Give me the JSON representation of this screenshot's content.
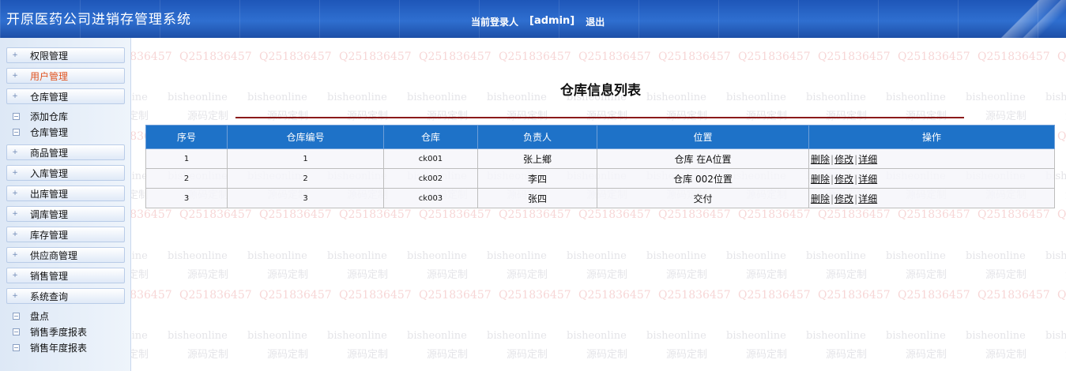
{
  "header": {
    "app_title": "开原医药公司进销存管理系统",
    "user_label": "当前登录人",
    "username": "[admin]",
    "logout": "退出"
  },
  "sidebar": {
    "items": [
      {
        "label": "权限管理",
        "active": false
      },
      {
        "label": "用户管理",
        "active": true
      },
      {
        "label": "仓库管理",
        "active": false
      },
      {
        "label": "添加仓库"
      },
      {
        "label": "仓库管理"
      },
      {
        "label": "商品管理",
        "active": false
      },
      {
        "label": "入库管理",
        "active": false
      },
      {
        "label": "出库管理",
        "active": false
      },
      {
        "label": "调库管理",
        "active": false
      },
      {
        "label": "库存管理",
        "active": false
      },
      {
        "label": "供应商管理",
        "active": false
      },
      {
        "label": "销售管理",
        "active": false
      },
      {
        "label": "系统查询",
        "active": false
      },
      {
        "label": "盘点"
      },
      {
        "label": "销售季度报表"
      },
      {
        "label": "销售年度报表"
      }
    ]
  },
  "watermark": {
    "qq": "Q2518364​57",
    "site": "bisheonline",
    "custom": "源码定制"
  },
  "main": {
    "title": "仓库信息列表",
    "columns": [
      "序号",
      "仓库编号",
      "仓库",
      "负责人",
      "位置",
      "操作"
    ],
    "rows": [
      {
        "no": "1",
        "code": "1",
        "name": "ck001",
        "manager": "张上鄉",
        "location": "仓库 在A位置"
      },
      {
        "no": "2",
        "code": "2",
        "name": "ck002",
        "manager": "李四",
        "location": "仓库 002位置"
      },
      {
        "no": "3",
        "code": "3",
        "name": "ck003",
        "manager": "张四",
        "location": "交付"
      }
    ],
    "actions": {
      "delete": "删除",
      "edit": "修改",
      "detail": "详细",
      "separator": "|"
    }
  },
  "colors": {
    "header_blue": "#2f6fd0",
    "table_header": "#1e72c8",
    "title_rule": "#8b1a1a",
    "active_menu": "#e0531e"
  }
}
